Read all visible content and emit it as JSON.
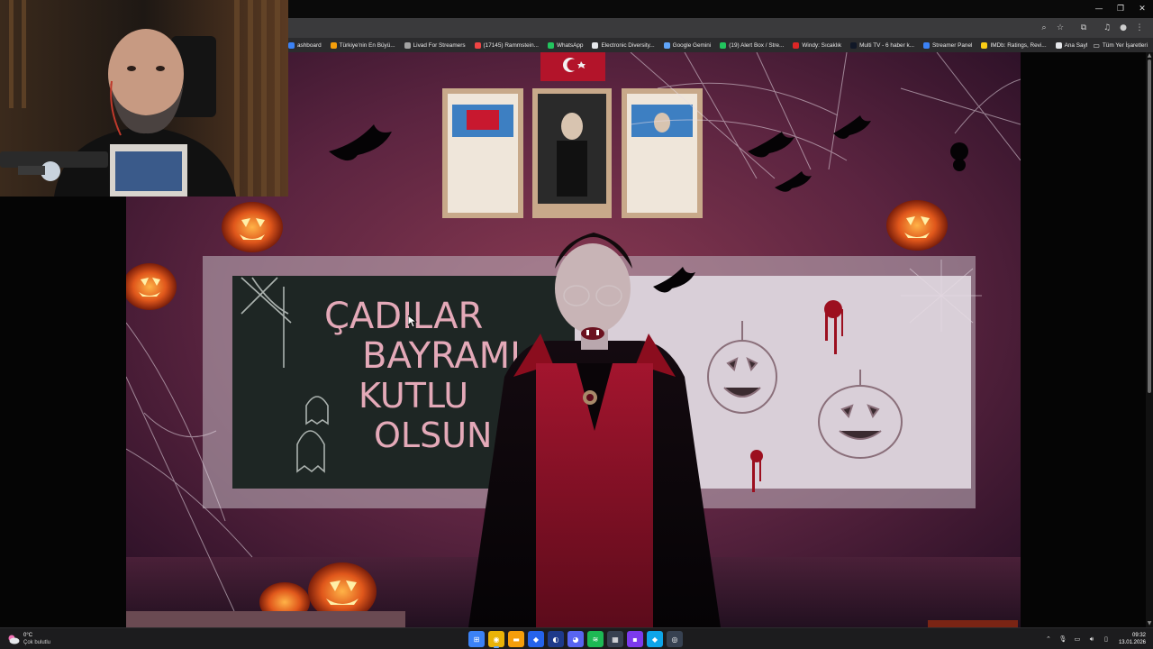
{
  "browser": {
    "bookmarks": [
      {
        "label": "ashboard",
        "color": "#3b82f6"
      },
      {
        "label": "Türkiye'nin En Büyü...",
        "color": "#f59e0b"
      },
      {
        "label": "Livad For Streamers",
        "color": "#a3a3a3"
      },
      {
        "label": "(17145) Rammstein...",
        "color": "#ef4444"
      },
      {
        "label": "WhatsApp",
        "color": "#22c55e"
      },
      {
        "label": "Electronic Diversity...",
        "color": "#e5e7eb"
      },
      {
        "label": "Google Gemini",
        "color": "#60a5fa"
      },
      {
        "label": "(19) Alert Box / Stre...",
        "color": "#22c55e"
      },
      {
        "label": "Windy: Sıcaklık",
        "color": "#dc2626"
      },
      {
        "label": "Multi TV - 6 haber k...",
        "color": "#111827"
      },
      {
        "label": "Streamer Panel",
        "color": "#3b82f6"
      },
      {
        "label": "IMDb: Ratings, Revi...",
        "color": "#facc15"
      },
      {
        "label": "Ana Sayfa • HBO Max",
        "color": "#e5e7eb"
      }
    ],
    "bookmarks_more": "»",
    "bookmarks_folder": "Tüm Yer İşaretleri",
    "toolbar_icons": [
      "zoom-icon",
      "star-icon",
      "extensions-icon",
      "media-icon",
      "profile-icon",
      "menu-icon"
    ]
  },
  "artwork": {
    "chalkboard_lines": [
      "ÇADILAR",
      "BAYRAMI",
      "KUTLU",
      "OLSUN"
    ]
  },
  "taskbar": {
    "weather_temp": "0°C",
    "weather_desc": "Çok bulutlu",
    "time": "09:32",
    "date": "13.01.2026",
    "apps": [
      {
        "name": "start-icon",
        "glyph": "⊞",
        "color": "#3b82f6",
        "active": false
      },
      {
        "name": "chrome-icon",
        "glyph": "◉",
        "color": "#eab308",
        "active": true
      },
      {
        "name": "file-explorer-icon",
        "glyph": "▬",
        "color": "#f59e0b",
        "active": false
      },
      {
        "name": "app-blue-icon",
        "glyph": "◆",
        "color": "#2563eb",
        "active": false
      },
      {
        "name": "steam-icon",
        "glyph": "◐",
        "color": "#1e3a8a",
        "active": false
      },
      {
        "name": "discord-icon",
        "glyph": "◕",
        "color": "#5865f2",
        "active": false
      },
      {
        "name": "spotify-icon",
        "glyph": "≋",
        "color": "#1db954",
        "active": false
      },
      {
        "name": "calculator-icon",
        "glyph": "▦",
        "color": "#374151",
        "active": false
      },
      {
        "name": "app-purple-icon",
        "glyph": "▪",
        "color": "#7c3aed",
        "active": false
      },
      {
        "name": "app-cyan-icon",
        "glyph": "◆",
        "color": "#0ea5e9",
        "active": false
      },
      {
        "name": "obs-icon",
        "glyph": "◎",
        "color": "#374151",
        "active": false
      }
    ]
  }
}
